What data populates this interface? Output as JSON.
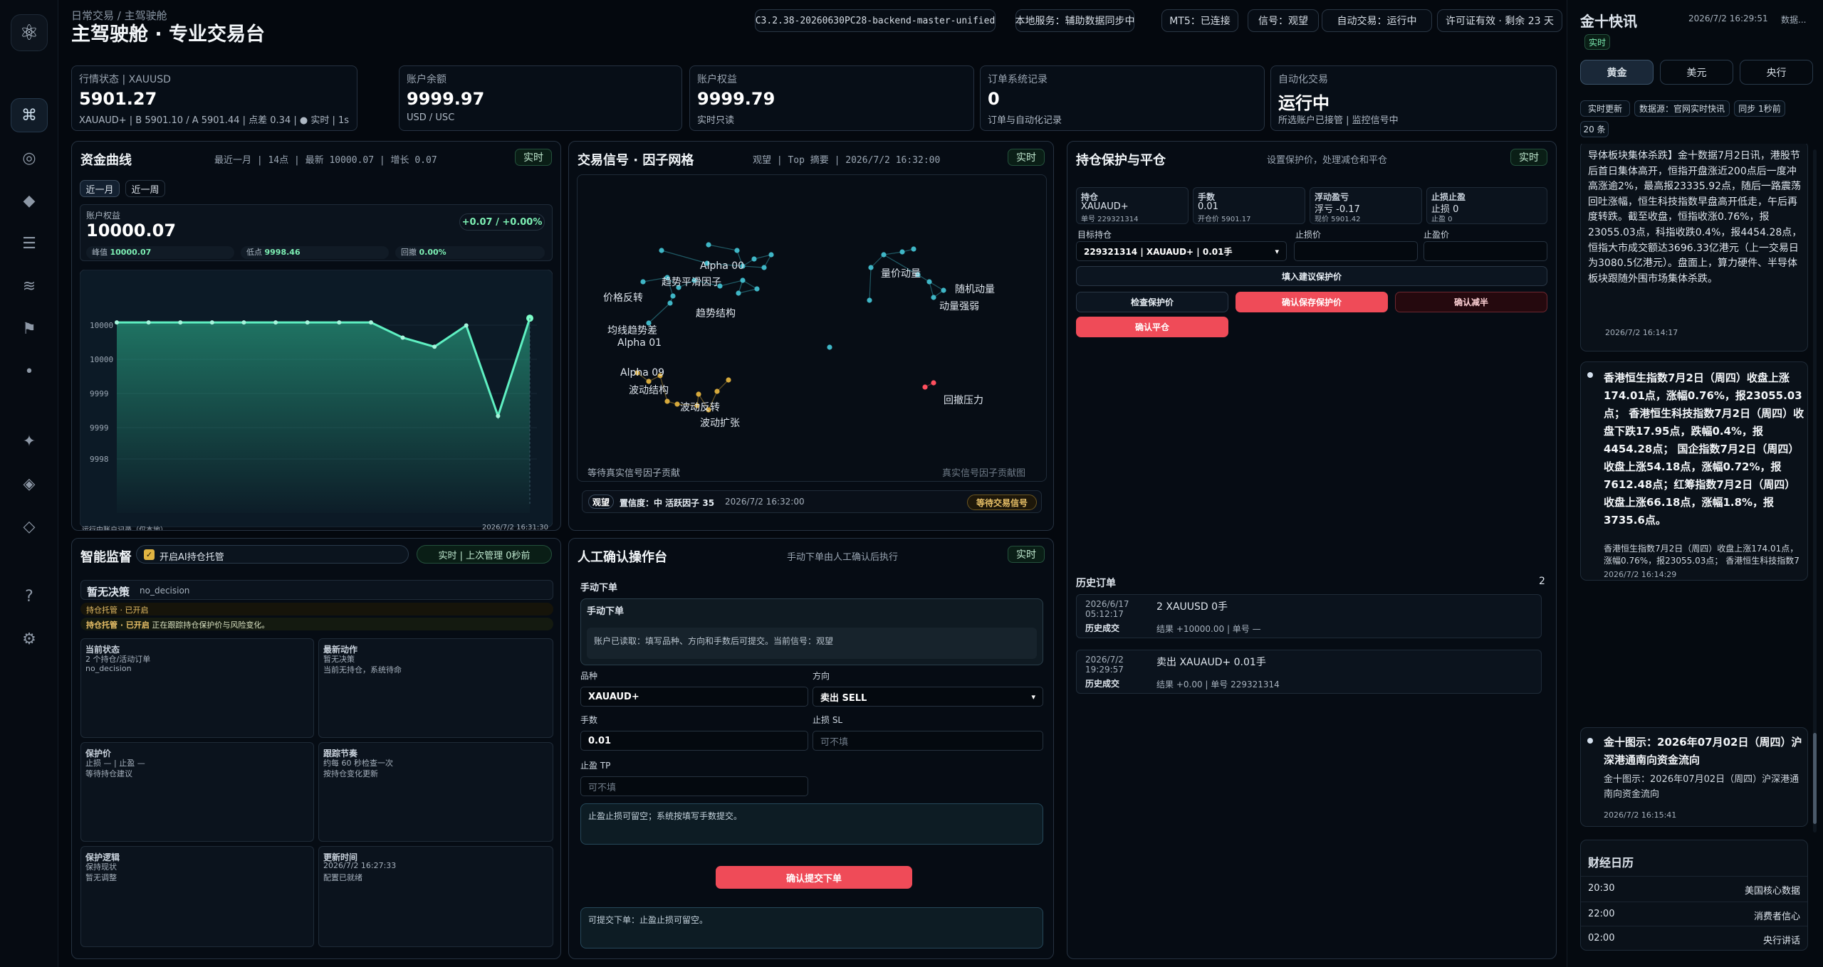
{
  "header": {
    "breadcrumb": "日常交易 / 主驾驶舱",
    "title": "主驾驶舱 · 专业交易台",
    "pills": [
      "C3.2.38-20260630PC28-backend-master-unified",
      "本地服务：辅助数据同步中",
      "MT5：已连接",
      "信号：观望",
      "自动交易：运行中",
      "许可证有效 · 剩余 23 天"
    ]
  },
  "rail": {
    "icons": [
      "logo-icon",
      "command-icon",
      "radio-icon",
      "diamond-icon",
      "list-icon",
      "wave-icon",
      "flag-icon",
      "dot-icon",
      "sparkle-icon",
      "layers-icon",
      "small-diamond-icon",
      "help-icon",
      "settings-icon"
    ],
    "glyphs": [
      "⚛",
      "⌘",
      "◎",
      "◆",
      "☰",
      "≋",
      "⚑",
      "•",
      "✦",
      "◈",
      "◇",
      "?",
      "⚙"
    ]
  },
  "cards": [
    {
      "label": "行情状态 | XAUUSD",
      "value": "5901.27",
      "sub": "XAUAUD+ | B 5901.10 / A 5901.44 | 点差 0.34 | ● 实时 | 1s"
    },
    {
      "label": "账户余额",
      "value": "9999.97",
      "sub": "USD / USC"
    },
    {
      "label": "账户权益",
      "value": "9999.79",
      "sub": "实时只读"
    },
    {
      "label": "订单系统记录",
      "value": "0",
      "sub": "订单与自动化记录"
    },
    {
      "label": "自动化交易",
      "value": "运行中",
      "sub": "所选账户已接管 | 监控信号中"
    }
  ],
  "equity": {
    "title": "资金曲线",
    "meta": "最近一月 | 14点 | 最新 10000.07 | 增长 0.07",
    "live": "实时",
    "tabs": [
      "近一月",
      "近一周"
    ],
    "label": "账户权益",
    "value": "10000.07",
    "change": "+0.07 / +0.00%",
    "stats": [
      {
        "k": "峰值",
        "v": "10000.07"
      },
      {
        "k": "低点",
        "v": "9998.46"
      },
      {
        "k": "回撤",
        "v": "0.00%"
      }
    ],
    "footer_left": "运行中账户记录（仅本地）",
    "footer_right": "2026/7/2 16:31:30"
  },
  "chart_data": {
    "type": "line",
    "ylim": [
      9997.8,
      10000.4
    ],
    "yticks": [
      "10000",
      "10000",
      "9999",
      "9999",
      "9998"
    ],
    "values": [
      10000.0,
      10000.0,
      10000.0,
      10000.0,
      10000.0,
      10000.0,
      10000.0,
      10000.0,
      10000.0,
      9999.75,
      9999.6,
      9999.95,
      9998.46,
      10000.07
    ]
  },
  "signal": {
    "title": "交易信号 · 因子网格",
    "meta": "观望 | Top 摘要 | 2026/7/2 16:32:00",
    "live": "实时",
    "labels": [
      "Alpha 00",
      "趋势平滑因子",
      "价格反转",
      "趋势结构",
      "均线趋势差",
      "Alpha 01",
      "量价动量",
      "随机动量",
      "动量强弱",
      "Alpha 09",
      "波动结构",
      "波动反转",
      "波动扩张",
      "回撤压力"
    ],
    "footer_left": "等待真实信号因子贡献",
    "footer_right": "真实信号因子贡献图",
    "status_tag": "观望",
    "status_text": "置信度：中 活跃因子 35",
    "status_time": "2026/7/2 16:32:00",
    "status_btn": "等待交易信号"
  },
  "protect": {
    "title": "持仓保护与平仓",
    "meta": "设置保护价，处理减仓和平仓",
    "live": "实时",
    "cells": [
      {
        "title": "持仓",
        "l1": "XAUAUD+",
        "l2": "单号 229321314"
      },
      {
        "title": "手数",
        "l1": "0.01",
        "l2": "开仓价 5901.17"
      },
      {
        "title": "浮动盈亏",
        "l1": "浮亏 -0.17",
        "l2": "现价 5901.42"
      },
      {
        "title": "止损止盈",
        "l1": "止损 0",
        "l2": "止盈 0"
      }
    ],
    "target_label": "目标持仓",
    "target_value": "229321314 | XAUAUD+ | 0.01手",
    "sl_label": "止损价",
    "tp_label": "止盈价",
    "fill_btn": "填入建议保护价",
    "check_btn": "检查保护价",
    "save_btn": "确认保存保护价",
    "reduce_btn": "确认减半",
    "close_btn": "确认平仓"
  },
  "history": {
    "title": "历史订单",
    "count": "2",
    "rows": [
      {
        "date": "2026/6/17 05:12:17",
        "kind": "历史成交",
        "title": "2 XAUUSD 0手",
        "detail": "结果 +10000.00 | 单号 —"
      },
      {
        "date": "2026/7/2 19:29:57",
        "kind": "历史成交",
        "title": "卖出 XAUAUD+ 0.01手",
        "detail": "结果 +0.00 | 单号 229321314"
      }
    ]
  },
  "monitor": {
    "title": "智能监督",
    "toggle": "开启AI持仓托管",
    "meta": "实时 | 上次管理 0秒前",
    "decision_title": "暂无决策",
    "decision_code": "no_decision",
    "line1": "持仓托管 · 已开启",
    "line2_tag": "持仓托管 · 已开启",
    "line2": "正在跟踪持仓保护价与风险变化。",
    "cells": [
      {
        "t": "当前状态",
        "l1": "2 个持仓/活动订单",
        "l2": "no_decision"
      },
      {
        "t": "最新动作",
        "l1": "暂无决策",
        "l2": "当前无持仓，系统待命"
      },
      {
        "t": "保护价",
        "l1": "止损 — | 止盈 —",
        "l2": "等待持仓建议"
      },
      {
        "t": "跟踪节奏",
        "l1": "约每 60 秒检查一次",
        "l2": "按持仓变化更新"
      },
      {
        "t": "保护逻辑",
        "l1": "保持现状",
        "l2": "暂无调整"
      },
      {
        "t": "更新时间",
        "l1": "2026/7/2 16:27:33",
        "l2": "配置已就绪"
      }
    ]
  },
  "manual": {
    "title": "人工确认操作台",
    "meta": "手动下单由人工确认后执行",
    "live": "实时",
    "sec": "手动下单",
    "box_title": "手动下单",
    "box_text": "账户已读取：填写品种、方向和手数后可提交。当前信号：观望",
    "sym_label": "品种",
    "sym": "XAUAUD+",
    "dir_label": "方向",
    "dir": "卖出 SELL",
    "lot_label": "手数",
    "lot": "0.01",
    "sl_label": "止损 SL",
    "sl_ph": "可不填",
    "tp_label": "止盈 TP",
    "tp_ph": "可不填",
    "note": "止盈止损可留空；系统按填写手数提交。",
    "submit": "确认提交下单",
    "footer": "可提交下单：止盈止损可留空。"
  },
  "news": {
    "title": "金十快讯",
    "datetime": "2026/7/2 16:29:51",
    "more": "数据...",
    "live": "实时",
    "tabs": [
      "黄金",
      "美元",
      "央行"
    ],
    "tags": [
      "实时更新",
      "数据源：官网实时快讯",
      "同步 1秒前",
      "20 条"
    ],
    "items": [
      {
        "bold": "",
        "text": "导体板块集体杀跌】金十数据7月2日讯，港股节后首日集体高开，恒指开盘涨近200点后一度冲高涨逾2%，最高报23335.92点，随后一路震荡回吐涨幅，恒生科技指数早盘高开低走，午后再度转跌。截至收盘，恒指收涨0.76%，报23055.03点，科指收跌0.4%，报4454.28点，恒指大市成交额达3696.33亿港元（上一交易日为3080.5亿港元）。盘面上，算力硬件、半导体板块跟随外围市场集体杀跌。",
        "time": "2026/7/2 16:14:17"
      },
      {
        "bold": "香港恒生指数7月2日（周四）收盘上涨174.01点，涨幅0.76%，报23055.03点； 香港恒生科技指数7月2日（周四）收盘下跌17.95点，跌幅0.4%，报4454.28点； 国企指数7月2日（周四）收盘上涨54.18点，涨幅0.72%，报7612.48点；红筹指数7月2日（周四）收盘上涨66.18点，涨幅1.8%，报3735.6点。",
        "text": "香港恒生指数7月2日（周四）收盘上涨174.01点，涨幅0.76%，报23055.03点； 香港恒生科技指数7月2日（周四）收盘下跌17.95点，跌幅0.4%，报4454.28点；国企指数7月2日（周四）收盘上涨54.18点，涨幅0.72%，报7612.48点； 红筹指数7月2日（周四）收盘上涨66.18点，涨幅1.8%，报3735.6点。",
        "time": "2026/7/2 16:14:29"
      },
      {
        "bold": "金十图示：2026年07月02日（周四）沪深港通南向资金流向",
        "text": "金十图示：2026年07月02日（周四）沪深港通南向资金流向",
        "time": "2026/7/2 16:15:41"
      }
    ],
    "calendar_title": "财经日历",
    "calendar": [
      {
        "time": "20:30",
        "event": "美国核心数据"
      },
      {
        "time": "22:00",
        "event": "消费者信心"
      },
      {
        "time": "02:00",
        "event": "央行讲话"
      }
    ]
  },
  "colors": {
    "green": "#43e0a5",
    "red": "#ff4f5e",
    "gold": "#d6a93c",
    "cyan": "#3fb6c6"
  }
}
